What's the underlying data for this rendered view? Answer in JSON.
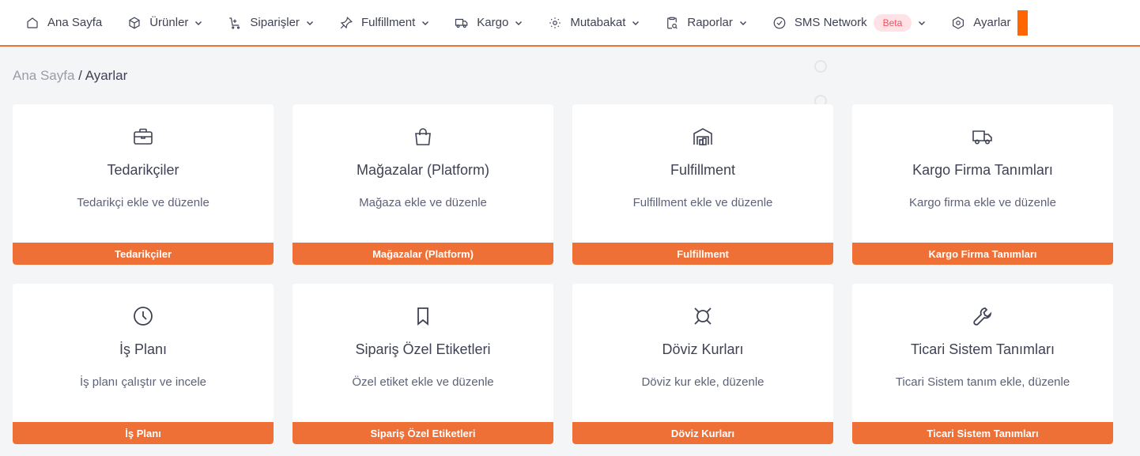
{
  "nav": {
    "items": [
      {
        "label": "Ana Sayfa",
        "icon": "home-icon",
        "dropdown": false
      },
      {
        "label": "Ürünler",
        "icon": "box-icon",
        "dropdown": true
      },
      {
        "label": "Siparişler",
        "icon": "orders-icon",
        "dropdown": true
      },
      {
        "label": "Fulfillment",
        "icon": "pin-icon",
        "dropdown": true
      },
      {
        "label": "Kargo",
        "icon": "truck-icon",
        "dropdown": true
      },
      {
        "label": "Mutabakat",
        "icon": "reconcile-icon",
        "dropdown": true
      },
      {
        "label": "Raporlar",
        "icon": "report-icon",
        "dropdown": true
      },
      {
        "label": "SMS Network",
        "icon": "check-circle-icon",
        "dropdown": true,
        "badge": "Beta"
      },
      {
        "label": "Ayarlar",
        "icon": "settings-icon",
        "dropdown": false
      }
    ],
    "accent": "#ee7036"
  },
  "breadcrumb": {
    "home": "Ana Sayfa",
    "separator": " / ",
    "current": "Ayarlar"
  },
  "cards": [
    {
      "icon": "briefcase-icon",
      "title": "Tedarikçiler",
      "desc": "Tedarikçi ekle ve düzenle",
      "button": "Tedarikçiler"
    },
    {
      "icon": "shopping-bag-icon",
      "title": "Mağazalar (Platform)",
      "desc": "Mağaza ekle ve düzenle",
      "button": "Mağazalar (Platform)"
    },
    {
      "icon": "warehouse-icon",
      "title": "Fulfillment",
      "desc": "Fulfillment ekle ve düzenle",
      "button": "Fulfillment"
    },
    {
      "icon": "truck-icon",
      "title": "Kargo Firma Tanımları",
      "desc": "Kargo firma ekle ve düzenle",
      "button": "Kargo Firma Tanımları"
    },
    {
      "icon": "clock-icon",
      "title": "İş Planı",
      "desc": "İş planı çalıştır ve incele",
      "button": "İş Planı"
    },
    {
      "icon": "bookmark-icon",
      "title": "Sipariş Özel Etiketleri",
      "desc": "Özel etiket ekle ve düzenle",
      "button": "Sipariş Özel Etiketleri"
    },
    {
      "icon": "currency-icon",
      "title": "Döviz Kurları",
      "desc": "Döviz kur ekle, düzenle",
      "button": "Döviz Kurları"
    },
    {
      "icon": "wrench-icon",
      "title": "Ticari Sistem Tanımları",
      "desc": "Ticari Sistem tanım ekle, düzenle",
      "button": "Ticari Sistem Tanımları"
    }
  ]
}
